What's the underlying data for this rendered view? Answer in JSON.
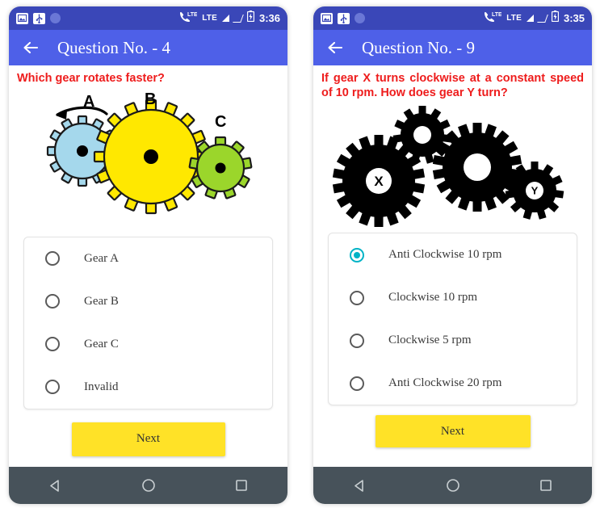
{
  "theme": {
    "statusbar_bg": "#3a47b8",
    "appbar_bg": "#4e60e8",
    "question_text_color": "#ee1c1c",
    "accent_selected": "#00b3c6",
    "next_button_bg": "#ffe227",
    "navbar_bg": "#47525a"
  },
  "screens": [
    {
      "id": "question-4",
      "statusbar": {
        "icons": [
          "image-icon",
          "usb-icon",
          "circle-icon"
        ],
        "network_label_1": "LTE",
        "network_label_2": "LTE",
        "signal_icons": [
          "signal-full-icon",
          "signal-empty-icon"
        ],
        "battery_icon": "battery-icon",
        "time": "3:36"
      },
      "appbar": {
        "back_icon": "back-arrow-icon",
        "title": "Question No. - 4"
      },
      "question": "Which gear rotates faster?",
      "diagram": {
        "name": "three-gear-train-diagram",
        "gears": [
          {
            "label": "A",
            "color": "#a5d8ec",
            "teeth": 12,
            "size": "small"
          },
          {
            "label": "B",
            "color": "#ffe800",
            "teeth": 16,
            "size": "large"
          },
          {
            "label": "C",
            "color": "#9bd62b",
            "teeth": 9,
            "size": "smallest"
          }
        ],
        "arrow": "counter-clockwise-arrow"
      },
      "options": [
        {
          "label": "Gear A",
          "selected": false
        },
        {
          "label": "Gear B",
          "selected": false
        },
        {
          "label": "Gear C",
          "selected": false
        },
        {
          "label": "Invalid",
          "selected": false
        }
      ],
      "next_label": "Next",
      "navbar": {
        "back": "nav-back-icon",
        "home": "nav-home-icon",
        "recents": "nav-recents-icon"
      }
    },
    {
      "id": "question-9",
      "statusbar": {
        "icons": [
          "image-icon",
          "usb-icon",
          "circle-icon"
        ],
        "network_label_1": "LTE",
        "network_label_2": "LTE",
        "signal_icons": [
          "signal-full-icon",
          "signal-empty-icon"
        ],
        "battery_icon": "battery-icon",
        "time": "3:35"
      },
      "appbar": {
        "back_icon": "back-arrow-icon",
        "title": "Question No. - 9"
      },
      "question": "If gear X turns clockwise at a constant speed of 10 rpm. How does gear Y turn?",
      "diagram": {
        "name": "four-gear-train-diagram",
        "gears": [
          {
            "label": "X",
            "color": "#000000",
            "teeth": 18,
            "size": "large"
          },
          {
            "label": "",
            "color": "#000000",
            "teeth": 11,
            "size": "small"
          },
          {
            "label": "",
            "color": "#000000",
            "teeth": 18,
            "size": "large"
          },
          {
            "label": "Y",
            "color": "#000000",
            "teeth": 11,
            "size": "small"
          }
        ]
      },
      "options": [
        {
          "label": "Anti Clockwise 10 rpm",
          "selected": true
        },
        {
          "label": "Clockwise 10 rpm",
          "selected": false
        },
        {
          "label": "Clockwise 5 rpm",
          "selected": false
        },
        {
          "label": "Anti Clockwise 20 rpm",
          "selected": false
        }
      ],
      "next_label": "Next",
      "navbar": {
        "back": "nav-back-icon",
        "home": "nav-home-icon",
        "recents": "nav-recents-icon"
      }
    }
  ]
}
